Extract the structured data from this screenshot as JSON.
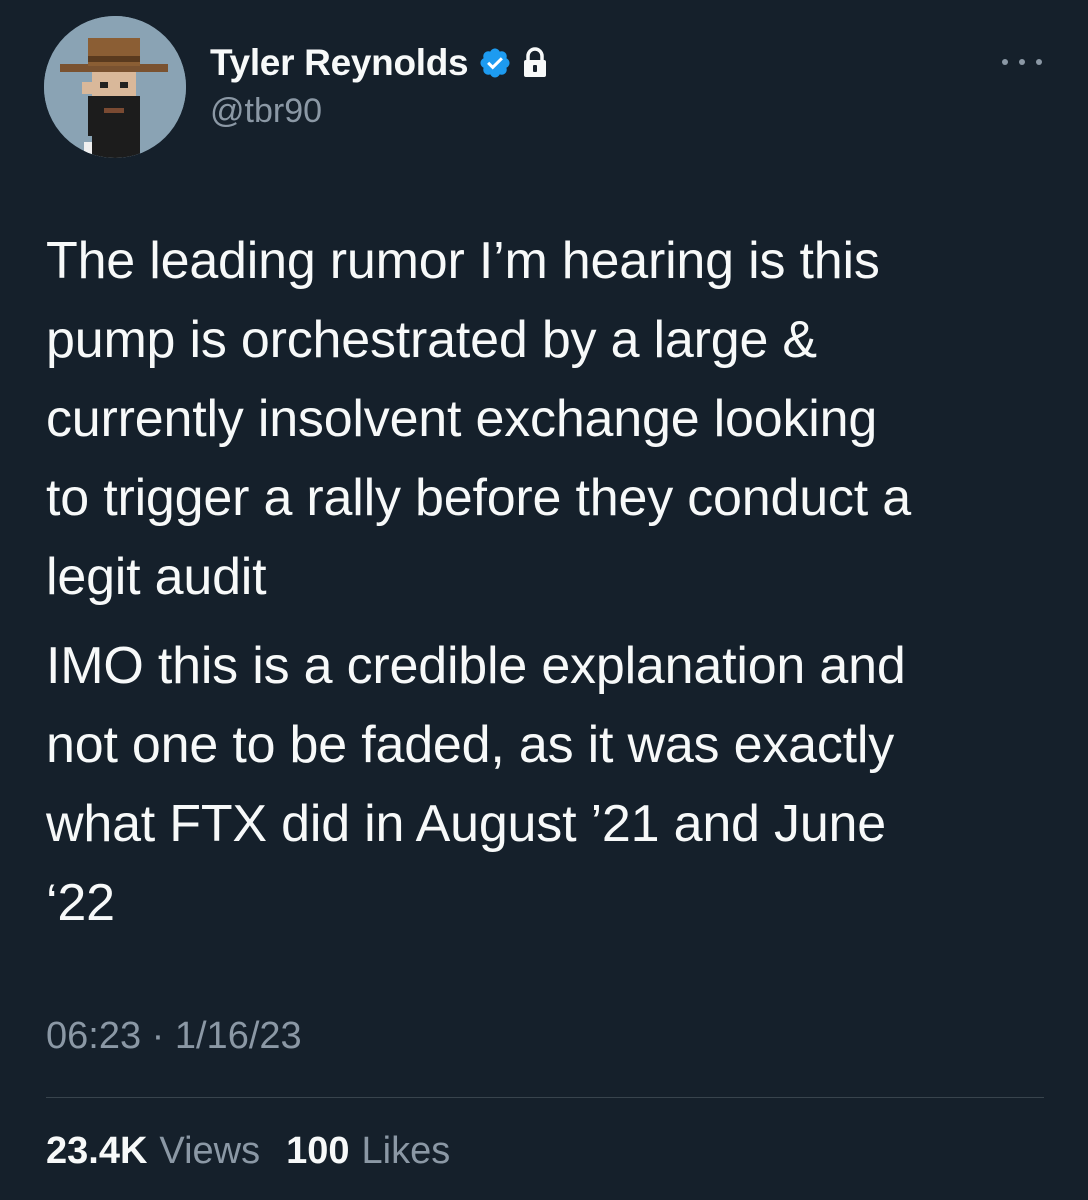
{
  "author": {
    "display_name": "Tyler Reynolds",
    "handle": "@tbr90",
    "verified_icon": "verified-badge-icon",
    "protected_icon": "lock-icon",
    "avatar_icon": "pixel-cowboy-avatar"
  },
  "more_icon": "more-options-icon",
  "tweet": {
    "paragraph_1": "The leading rumor I’m hearing is this\npump is orchestrated by a large &\ncurrently insolvent exchange looking\nto trigger a rally before they conduct a\nlegit audit",
    "paragraph_2": "IMO this is a credible explanation and\nnot one to be faded, as it was exactly\nwhat FTX did in August ’21 and June\n‘22"
  },
  "timestamp": "06:23 · 1/16/23",
  "stats": {
    "views_count": "23.4K",
    "views_label": "Views",
    "likes_count": "100",
    "likes_label": "Likes"
  },
  "colors": {
    "background": "#15202b",
    "primary_text": "#f7f9f9",
    "secondary_text": "#8b98a5",
    "verified_blue": "#1d9bf0"
  }
}
